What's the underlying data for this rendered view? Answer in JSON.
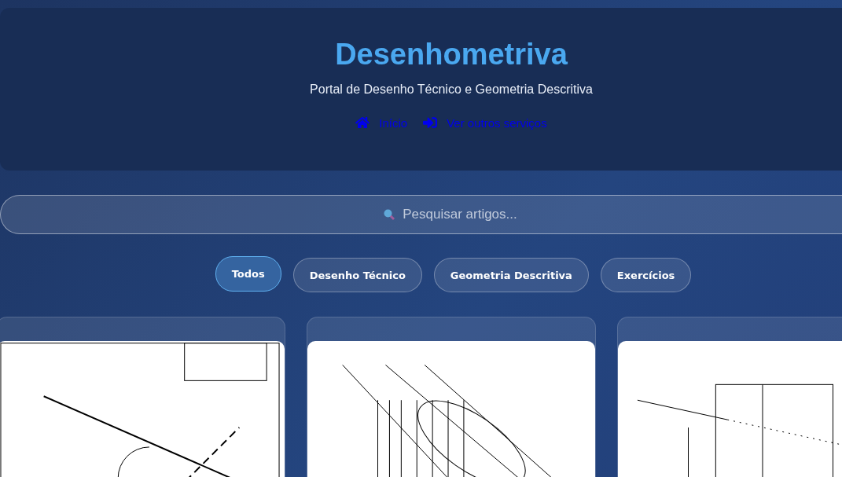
{
  "header": {
    "title": "Desenhometriva",
    "subtitle": "Portal de Desenho Técnico e Geometria Descritiva",
    "nav": [
      {
        "kind": "home",
        "label": "Início"
      },
      {
        "kind": "signin",
        "label": "Ver outros serviços"
      }
    ]
  },
  "search": {
    "placeholder": "Pesquisar artigos..."
  },
  "filters": [
    {
      "label": "Todos",
      "selected": true
    },
    {
      "label": "Desenho Técnico",
      "selected": false
    },
    {
      "label": "Geometria Descritiva",
      "selected": false
    },
    {
      "label": "Exercícios",
      "selected": false
    }
  ],
  "cards": [
    {
      "kind": "lines"
    },
    {
      "kind": "ellipse"
    },
    {
      "kind": "box"
    }
  ]
}
